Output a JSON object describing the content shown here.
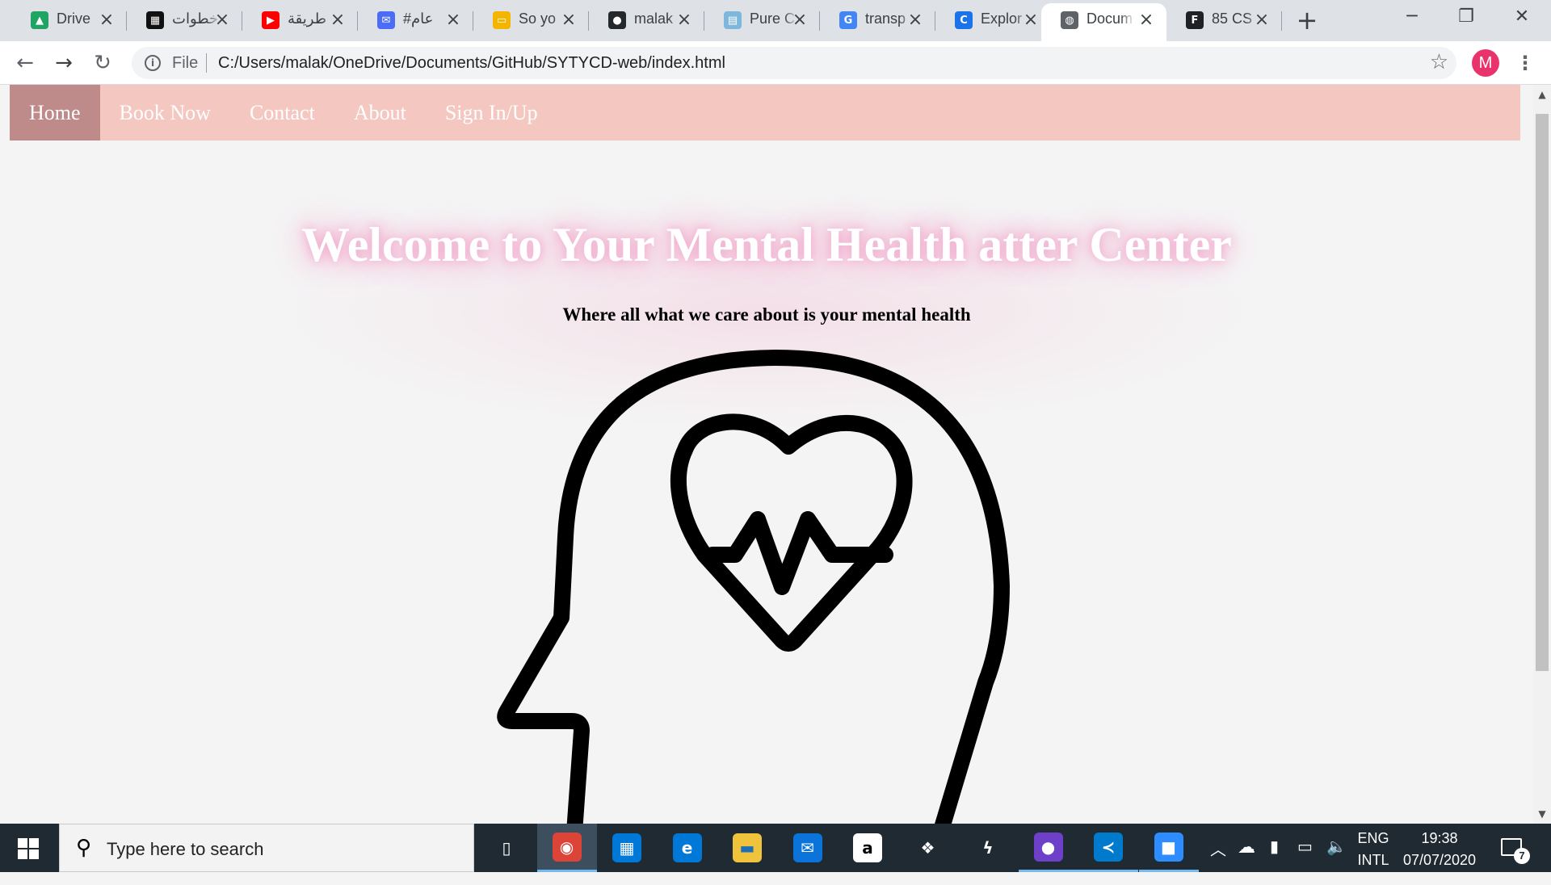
{
  "browser": {
    "tabs": [
      {
        "title": "Drive",
        "icon": "google-drive-icon",
        "color": "#1fa463"
      },
      {
        "title": "خطوات",
        "icon": "site-logo-icon",
        "color": "#111111"
      },
      {
        "title": "طريقة",
        "icon": "youtube-icon",
        "color": "#ff0000"
      },
      {
        "title": "#عام",
        "icon": "chat-app-icon",
        "color": "#4a6cf7"
      },
      {
        "title": "So yo",
        "icon": "slides-icon",
        "color": "#f4b400"
      },
      {
        "title": "malak",
        "icon": "github-icon",
        "color": "#24292e"
      },
      {
        "title": "Pure C",
        "icon": "image-icon",
        "color": "#7fb6dc"
      },
      {
        "title": "transp",
        "icon": "google-icon",
        "color": "#4285f4"
      },
      {
        "title": "Explor",
        "icon": "c-logo-icon",
        "color": "#1a73e8"
      },
      {
        "title": "Docum",
        "icon": "globe-icon",
        "color": "#5f6368",
        "active": true
      },
      {
        "title": "85 CS",
        "icon": "f-logo-icon",
        "color": "#202124"
      }
    ],
    "new_tab_symbol": "+",
    "window_controls": {
      "minimize": "─",
      "restore": "❐",
      "close": "✕"
    },
    "address": {
      "scheme_label": "File",
      "url": "C:/Users/malak/OneDrive/Documents/GitHub/SYTYCD-web/index.html"
    },
    "profile_initial": "M",
    "profile_color": "#e8336d"
  },
  "site": {
    "nav": [
      {
        "label": "Home",
        "active": true
      },
      {
        "label": "Book Now"
      },
      {
        "label": "Contact"
      },
      {
        "label": "About"
      },
      {
        "label": "Sign In/Up"
      }
    ],
    "nav_color": "#f5c7c1",
    "nav_active_color": "#bf8a8a",
    "hero_title": "Welcome to Your Mental Health atter Center",
    "hero_subtitle": "Where all what we care about is your mental health",
    "illustration": "head-with-heartbeat-icon"
  },
  "taskbar": {
    "search_placeholder": "Type here to search",
    "apps": [
      {
        "name": "task-view-icon"
      },
      {
        "name": "chrome-icon",
        "focused": true
      },
      {
        "name": "microsoft-store-icon"
      },
      {
        "name": "edge-icon"
      },
      {
        "name": "file-explorer-icon"
      },
      {
        "name": "mail-icon"
      },
      {
        "name": "amazon-icon"
      },
      {
        "name": "dropbox-icon"
      },
      {
        "name": "winamp-icon"
      },
      {
        "name": "github-desktop-icon",
        "running": true
      },
      {
        "name": "vscode-icon",
        "running": true
      },
      {
        "name": "zoom-icon",
        "running": true
      }
    ],
    "language": "ENG",
    "layout": "INTL",
    "time": "19:38",
    "date": "07/07/2020",
    "notification_count": "7"
  }
}
